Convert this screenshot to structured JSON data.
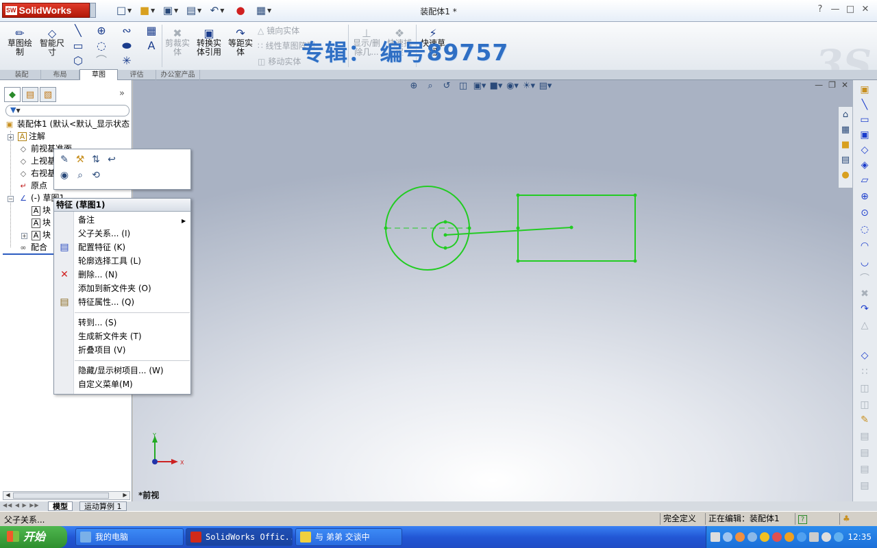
{
  "app": {
    "logo": "SolidWorks",
    "document_title": "装配体1 *",
    "watermark": "专辑：  编号89757",
    "help_label": "?"
  },
  "ribbon": {
    "sketch": "草图绘\n制",
    "smart_dim": "智能尺\n寸",
    "trim": "剪裁实\n体",
    "convert": "转换实\n体引用",
    "offset": "等距实\n体",
    "mirror": "镜向实体",
    "linear_pattern": "线性草图阵列",
    "move": "移动实体",
    "show_delete": "显示/删\n除几...",
    "quick_snap": "快速捕\n捉",
    "rapid_sketch": "快速草\n图"
  },
  "command_tabs": [
    "装配",
    "布局",
    "草图",
    "评估",
    "办公室产品"
  ],
  "active_command_tab": 2,
  "tree": {
    "root": "装配体1 (默认<默认_显示状态",
    "items": [
      {
        "label": "注解",
        "icon": "annotation-icon"
      },
      {
        "label": "前视基准面",
        "icon": "plane-icon"
      },
      {
        "label": "上视基",
        "icon": "plane-icon"
      },
      {
        "label": "右视基",
        "icon": "plane-icon"
      },
      {
        "label": "原点",
        "icon": "origin-icon"
      },
      {
        "label": "(-) 草图1",
        "icon": "sketch-icon"
      },
      {
        "label": "块",
        "icon": "block-icon"
      },
      {
        "label": "块",
        "icon": "block-icon"
      },
      {
        "label": "块",
        "icon": "block-icon"
      },
      {
        "label": "配合",
        "icon": "mates-icon"
      }
    ]
  },
  "context_menu": {
    "header": "特征 (草图1)",
    "items": [
      {
        "label": "备注",
        "shortcut": "",
        "submenu": true
      },
      {
        "label": "父子关系...",
        "shortcut": "(I)"
      },
      {
        "label": "配置特征",
        "shortcut": "(K)"
      },
      {
        "label": "轮廓选择工具",
        "shortcut": "(L)"
      },
      {
        "label": "删除...",
        "shortcut": "(N)"
      },
      {
        "label": "添加到新文件夹",
        "shortcut": "(O)"
      },
      {
        "label": "特征属性...",
        "shortcut": "(Q)"
      },
      {
        "label": "转到...",
        "shortcut": "(S)"
      },
      {
        "label": "生成新文件夹",
        "shortcut": "(T)"
      },
      {
        "label": "折叠项目",
        "shortcut": "(V)"
      },
      {
        "label": "隐藏/显示树项目...",
        "shortcut": "(W)"
      },
      {
        "label": "自定义菜单",
        "shortcut": "(M)"
      }
    ]
  },
  "graphics": {
    "view_label": "*前视",
    "sketch_color": "#22cc22",
    "triad": {
      "x": "X",
      "y": "Y"
    }
  },
  "bottom_tabs": [
    "模型",
    "运动算例 1"
  ],
  "status": {
    "message": "父子关系...",
    "definition": "完全定义",
    "editing": "正在编辑：装配体1",
    "help_icon": "?"
  },
  "taskbar": {
    "start": "开始",
    "tasks": [
      "我的电脑",
      "SolidWorks Offic...",
      "与 弟弟 交谈中"
    ],
    "clock": "12:35"
  }
}
